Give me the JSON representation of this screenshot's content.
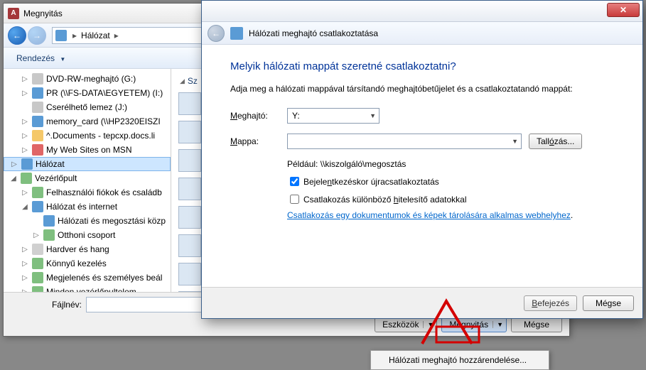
{
  "open_dialog": {
    "title": "Megnyitás",
    "breadcrumb": {
      "root": "Hálózat"
    },
    "toolbar": {
      "organize": "Rendezés"
    },
    "tree": [
      {
        "label": "DVD-RW-meghajtó (G:)",
        "icon": "drive",
        "indent": 1,
        "tw": "▷"
      },
      {
        "label": "PR (\\\\FS-DATA\\EGYETEM) (I:)",
        "icon": "net",
        "indent": 1,
        "tw": "▷"
      },
      {
        "label": "Cserélhető lemez (J:)",
        "icon": "drive",
        "indent": 1,
        "tw": ""
      },
      {
        "label": "memory_card (\\\\HP2320EISZI",
        "icon": "net",
        "indent": 1,
        "tw": "▷"
      },
      {
        "label": "^.Documents - tepcxp.docs.li",
        "icon": "folder",
        "indent": 1,
        "tw": "▷"
      },
      {
        "label": "My Web Sites on MSN",
        "icon": "web",
        "indent": 1,
        "tw": "▷"
      },
      {
        "label": "Hálózat",
        "icon": "net",
        "indent": 0,
        "tw": "▷",
        "selected": true
      },
      {
        "label": "Vezérlőpult",
        "icon": "ctrl",
        "indent": 0,
        "tw": "◢"
      },
      {
        "label": "Felhasználói fiókok és családb",
        "icon": "ctrl",
        "indent": 1,
        "tw": "▷"
      },
      {
        "label": "Hálózat és internet",
        "icon": "net",
        "indent": 1,
        "tw": "◢"
      },
      {
        "label": "Hálózati és megosztási közp",
        "icon": "net",
        "indent": 2,
        "tw": ""
      },
      {
        "label": "Otthoni csoport",
        "icon": "ctrl",
        "indent": 2,
        "tw": "▷"
      },
      {
        "label": "Hardver és hang",
        "icon": "generic",
        "indent": 1,
        "tw": "▷"
      },
      {
        "label": "Könnyű kezelés",
        "icon": "ctrl",
        "indent": 1,
        "tw": "▷"
      },
      {
        "label": "Megjelenés és személyes beál",
        "icon": "ctrl",
        "indent": 1,
        "tw": "▷"
      },
      {
        "label": "Minden vezérlőpultelem",
        "icon": "ctrl",
        "indent": 1,
        "tw": "▷"
      }
    ],
    "group_header": "Sz",
    "filename_label": "Fájlnév:",
    "filename_value": "",
    "buttons": {
      "tools": "Eszközök",
      "open": "Megnyitás",
      "cancel": "Mégse"
    },
    "drop_menu": {
      "item": "Hálózati meghajtó hozzárendelése..."
    }
  },
  "wizard": {
    "header": "Hálózati meghajtó csatlakoztatása",
    "h1": "Melyik hálózati mappát szeretné csatlakoztatni?",
    "intro": "Adja meg a hálózati mappával társítandó meghajtóbetűjelet és a csatlakoztatandó mappát:",
    "drive_label": "Meghajtó:",
    "drive_value": "Y:",
    "folder_label": "Mappa:",
    "folder_value": "",
    "browse": "Tallózás...",
    "example": "Például: \\\\kiszolgáló\\megosztás",
    "reconnect": "Bejelentkezéskor újracsatlakoztatás",
    "othercred": "Csatlakozás különböző hitelesítő adatokkal",
    "link": "Csatlakozás egy dokumentumok és képek tárolására alkalmas webhelyhez",
    "finish": "Befejezés",
    "cancel": "Mégse"
  }
}
